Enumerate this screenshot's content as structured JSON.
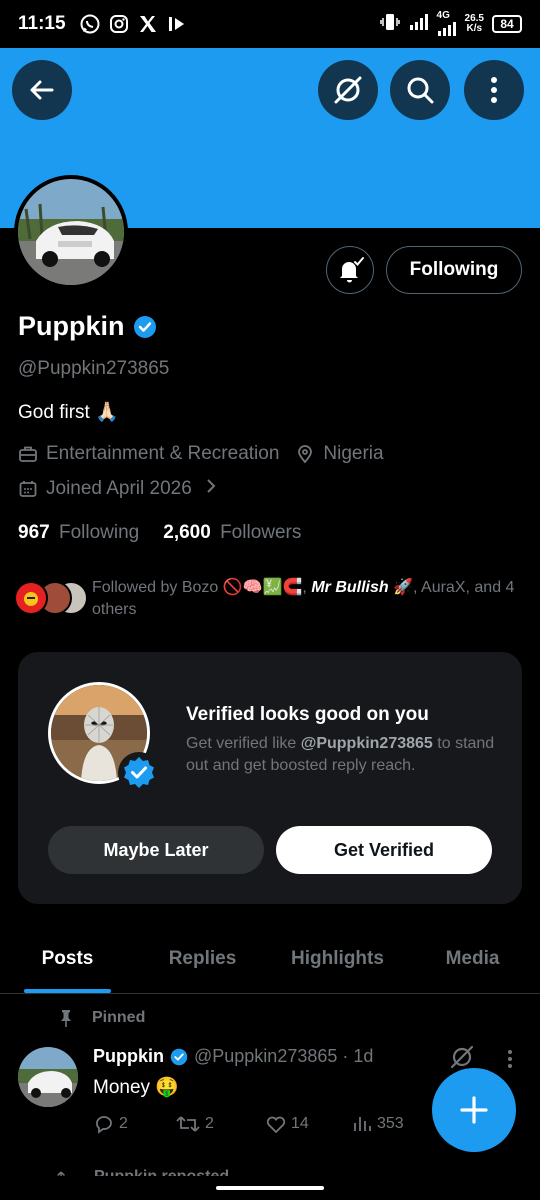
{
  "status_bar": {
    "time": "11:15",
    "net_speed_value": "26.5",
    "net_speed_unit": "K/s",
    "network_type": "4G",
    "battery": "84"
  },
  "profile": {
    "name": "Puppkin",
    "handle": "@Puppkin273865",
    "bio": "God first 🙏🏻",
    "category": "Entertainment & Recreation",
    "location": "Nigeria",
    "joined": "Joined April 2026",
    "following_count": "967",
    "following_label": "Following",
    "followers_count": "2,600",
    "followers_label": "Followers",
    "follow_button_label": "Following",
    "followed_by_prefix": "Followed by Bozo 🚫🧠💹🧲, ",
    "followed_by_strong": "Mr Bullish",
    "followed_by_suffix": " 🚀, AuraX, and 4 others"
  },
  "verify_card": {
    "title": "Verified looks good on you",
    "desc_prefix": "Get verified like ",
    "desc_handle": "@Puppkin273865",
    "desc_suffix": " to stand out and get boosted reply reach.",
    "maybe_label": "Maybe Later",
    "get_label": "Get Verified"
  },
  "tabs": [
    {
      "label": "Posts",
      "active": true
    },
    {
      "label": "Replies"
    },
    {
      "label": "Highlights"
    },
    {
      "label": "Media"
    }
  ],
  "post": {
    "pinned_label": "Pinned",
    "author": "Puppkin",
    "handle_time": "@Puppkin273865 · 1d",
    "text": "Money 🤑",
    "replies": "2",
    "reposts": "2",
    "likes": "14",
    "views": "353"
  },
  "next_post": {
    "reposted_label": "Puppkin reposted"
  },
  "colors": {
    "accent": "#1d9bf0",
    "banner": "#1d9bf0",
    "background": "#000000",
    "muted": "#71767b"
  }
}
